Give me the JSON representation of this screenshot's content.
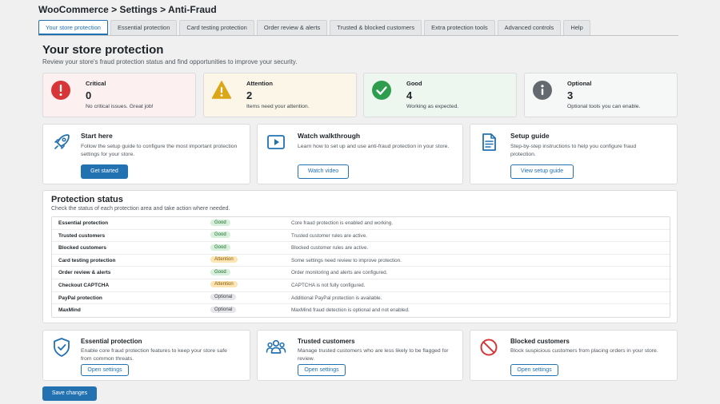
{
  "breadcrumb": "WooCommerce > Settings > Anti-Fraud",
  "tabs": [
    {
      "label": "Your store protection"
    },
    {
      "label": "Essential protection"
    },
    {
      "label": "Card testing protection"
    },
    {
      "label": "Order review & alerts"
    },
    {
      "label": "Trusted & blocked customers"
    },
    {
      "label": "Extra protection tools"
    },
    {
      "label": "Advanced controls"
    },
    {
      "label": "Help"
    }
  ],
  "header": {
    "title": "Your store protection",
    "subtitle": "Review your store's fraud protection status and find opportunities to improve your security."
  },
  "stats": [
    {
      "label": "Critical",
      "value": "0",
      "desc": "No critical issues. Great job!",
      "color": "#d63638",
      "icon": "exclamation-circle-icon"
    },
    {
      "label": "Attention",
      "value": "2",
      "desc": "Items need your attention.",
      "color": "#dba617",
      "icon": "warning-triangle-icon"
    },
    {
      "label": "Good",
      "value": "4",
      "desc": "Working as expected.",
      "color": "#2e9d4e",
      "icon": "check-circle-icon"
    },
    {
      "label": "Optional",
      "value": "3",
      "desc": "Optional tools you can enable.",
      "color": "#646970",
      "icon": "info-circle-icon"
    }
  ],
  "actions": [
    {
      "title": "Start here",
      "desc": "Follow the setup guide to configure the most important protection settings for your store.",
      "button": "Get started",
      "icon": "rocket-icon"
    },
    {
      "title": "Watch walkthrough",
      "desc": "Learn how to set up and use anti-fraud protection in your store.",
      "button": "Watch video",
      "icon": "video-play-icon"
    },
    {
      "title": "Setup guide",
      "desc": "Step-by-step instructions to help you configure fraud protection.",
      "button": "View setup guide",
      "icon": "document-icon"
    }
  ],
  "status": {
    "title": "Protection status",
    "subtitle": "Check the status of each protection area and take action where needed.",
    "rows": [
      {
        "name": "Essential protection",
        "badge": "Good",
        "desc": "Core fraud protection is enabled and working."
      },
      {
        "name": "Trusted customers",
        "badge": "Good",
        "desc": "Trusted customer rules are active."
      },
      {
        "name": "Blocked customers",
        "badge": "Good",
        "desc": "Blocked customer rules are active."
      },
      {
        "name": "Card testing protection",
        "badge": "Attention",
        "desc": "Some settings need review to improve protection."
      },
      {
        "name": "Order review & alerts",
        "badge": "Good",
        "desc": "Order monitoring and alerts are configured."
      },
      {
        "name": "Checkout CAPTCHA",
        "badge": "Attention",
        "desc": "CAPTCHA is not fully configured."
      },
      {
        "name": "PayPal protection",
        "badge": "Optional",
        "desc": "Additional PayPal protection is available."
      },
      {
        "name": "MaxMind",
        "badge": "Optional",
        "desc": "MaxMind fraud detection is optional and not enabled."
      }
    ]
  },
  "features": [
    {
      "title": "Essential protection",
      "desc": "Enable core fraud protection features to keep your store safe from common threats.",
      "button": "Open settings",
      "icon": "shield-check-icon"
    },
    {
      "title": "Trusted customers",
      "desc": "Manage trusted customers who are less likely to be flagged for review.",
      "button": "Open settings",
      "icon": "users-icon"
    },
    {
      "title": "Blocked customers",
      "desc": "Block suspicious customers from placing orders in your store.",
      "button": "Open settings",
      "icon": "block-icon"
    }
  ],
  "save_button": "Save changes",
  "colors": {
    "accent": "#2271b1",
    "good": "#2e9d4e",
    "attention": "#dba617",
    "critical": "#d63638",
    "optional": "#646970"
  }
}
